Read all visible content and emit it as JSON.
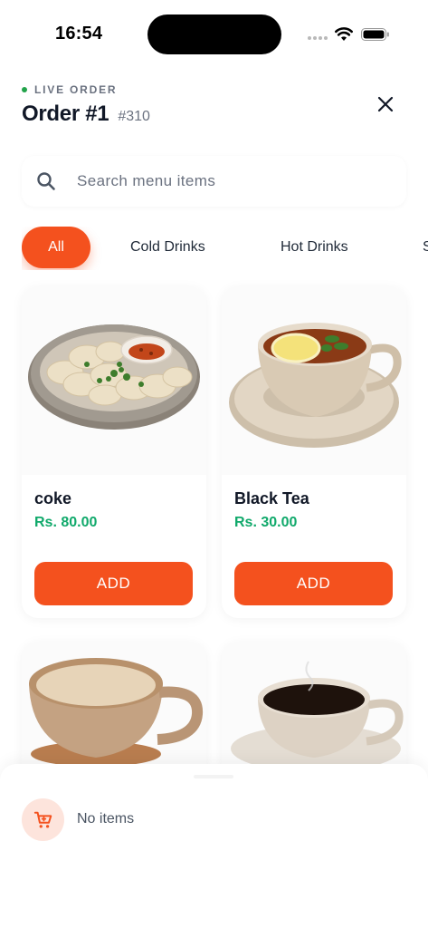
{
  "status_bar": {
    "time": "16:54"
  },
  "header": {
    "live_label": "LIVE ORDER",
    "title": "Order #1",
    "order_number": "#310"
  },
  "search": {
    "placeholder": "Search menu items",
    "value": ""
  },
  "categories": [
    {
      "label": "All",
      "active": true
    },
    {
      "label": "Cold Drinks",
      "active": false
    },
    {
      "label": "Hot Drinks",
      "active": false
    },
    {
      "label": "S",
      "active": false
    }
  ],
  "menu_items": [
    {
      "name": "coke",
      "price": "Rs. 80.00",
      "button": "ADD",
      "image": "momo-plate"
    },
    {
      "name": "Black Tea",
      "price": "Rs. 30.00",
      "button": "ADD",
      "image": "lemon-tea-cup"
    },
    {
      "name": "",
      "price": "",
      "button": "",
      "image": "cappuccino-cup"
    },
    {
      "name": "",
      "price": "",
      "button": "",
      "image": "black-coffee-cup"
    }
  ],
  "cart": {
    "status": "No items",
    "icon": "cart-icon"
  },
  "colors": {
    "accent": "#f4511e",
    "price": "#10a96b",
    "live": "#22a34a",
    "cart_icon_bg": "#fde4dc"
  }
}
